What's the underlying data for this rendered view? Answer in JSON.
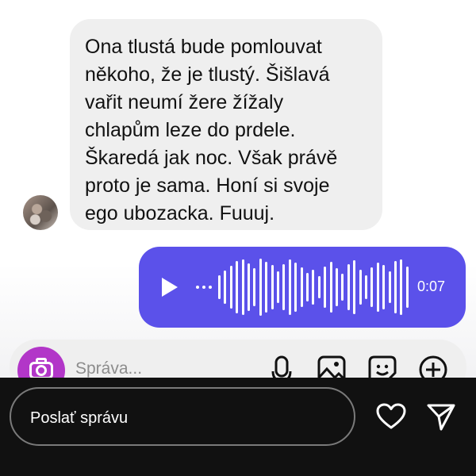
{
  "incoming_message": {
    "lines": [
      "Ona tlustá bude pomlouvat",
      "někoho, že je tlustý. Šišlavá",
      "vařit neumí žere žížaly",
      "chlapům leze do prdele.",
      "Škaredá jak noc. Však právě",
      "proto je sama. Honí si svoje",
      "ego ubozacka. Fuuuj."
    ]
  },
  "voice_message": {
    "duration": "0:07",
    "accent_color": "#5b51ea"
  },
  "composer": {
    "placeholder": "Správa...",
    "camera_color": "#b236c8",
    "icons": [
      "camera-icon",
      "microphone-icon",
      "gallery-icon",
      "sticker-icon",
      "add-icon"
    ]
  },
  "reply_bar": {
    "placeholder": "Poslať správu",
    "icons": [
      "heart-icon",
      "send-icon"
    ]
  }
}
